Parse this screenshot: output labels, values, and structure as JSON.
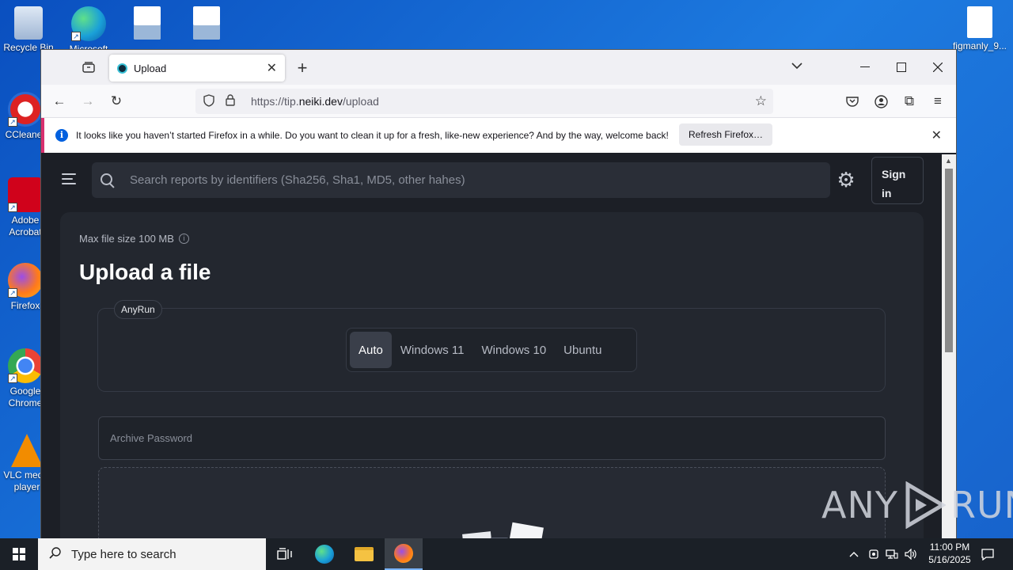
{
  "desktop": {
    "icons": [
      {
        "label": "Recycle Bin"
      },
      {
        "label": "Microsoft Edge"
      },
      {
        "label": ""
      },
      {
        "label": ""
      },
      {
        "label": "CCleaner"
      },
      {
        "label": "Adobe Acrobat"
      },
      {
        "label": "Firefox"
      },
      {
        "label": "Google Chrome"
      },
      {
        "label": "VLC media player"
      },
      {
        "label": "figmanly_9..."
      }
    ]
  },
  "browser": {
    "tab_title": "Upload",
    "url_prefix": "https://tip.",
    "url_domain": "neiki.dev",
    "url_path": "/upload",
    "notification": {
      "message": "It looks like you haven’t started Firefox in a while. Do you want to clean it up for a fresh, like-new experience? And by the way, welcome back!",
      "button": "Refresh Firefox…"
    }
  },
  "page": {
    "search_placeholder": "Search reports by identifiers (Sha256, Sha1, MD5, other hahes)",
    "sign_in": "Sign in",
    "max_file_size": "Max file size 100 MB",
    "heading": "Upload a file",
    "sandbox_tag": "AnyRun",
    "os_options": [
      "Auto",
      "Windows 11",
      "Windows 10",
      "Ubuntu"
    ],
    "os_selected": "Auto",
    "archive_password_placeholder": "Archive Password"
  },
  "watermark": {
    "left": "ANY",
    "right": "RUN"
  },
  "taskbar": {
    "search_placeholder": "Type here to search",
    "time": "11:00 PM",
    "date": "5/16/2025"
  }
}
